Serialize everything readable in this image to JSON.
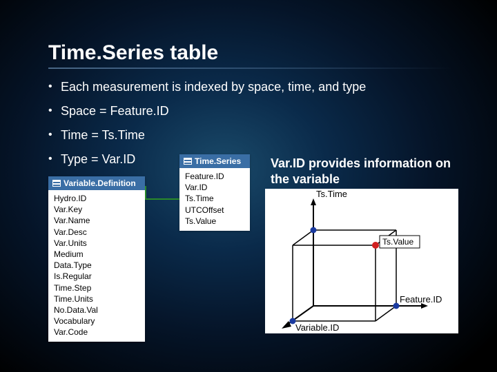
{
  "title": "Time.Series table",
  "bullets": [
    "Each measurement is indexed by space, time, and type",
    "Space = Feature.ID",
    "Time  = Ts.Time",
    "Type = Var.ID"
  ],
  "caption": "Var.ID provides information on the variable",
  "panels": {
    "variable": {
      "header": "Variable.Definition",
      "fields": [
        "Hydro.ID",
        "Var.Key",
        "Var.Name",
        "Var.Desc",
        "Var.Units",
        "Medium",
        "Data.Type",
        "Is.Regular",
        "Time.Step",
        "Time.Units",
        "No.Data.Val",
        "Vocabulary",
        "Var.Code"
      ]
    },
    "timeseries": {
      "header": "Time.Series",
      "fields": [
        "Feature.ID",
        "Var.ID",
        "Ts.Time",
        "UTCOffset",
        "Ts.Value"
      ]
    }
  },
  "diagram": {
    "axis_x": "Feature.ID",
    "axis_y": "Ts.Time",
    "axis_z": "Variable.ID",
    "point_label": "Ts.Value"
  }
}
